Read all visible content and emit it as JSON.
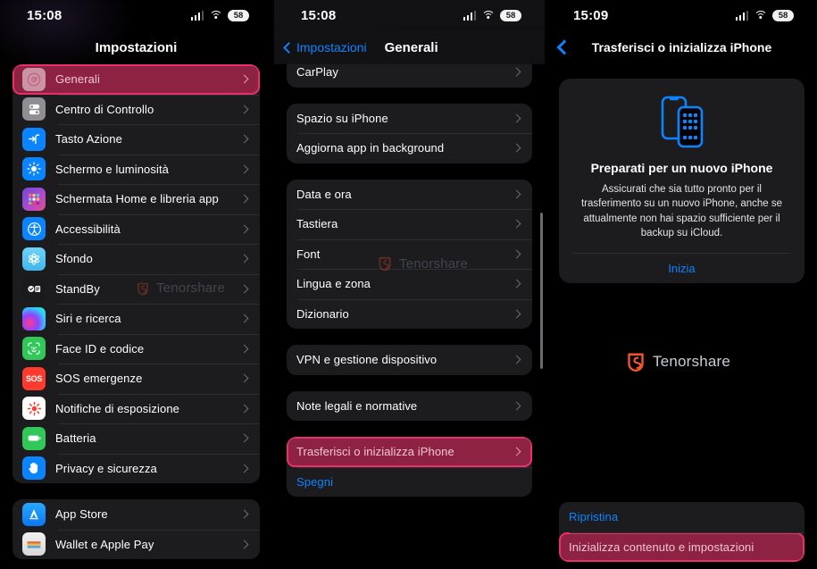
{
  "panels": {
    "left": {
      "status": {
        "time": "15:08",
        "battery": "58"
      },
      "nav_title": "Impostazioni",
      "groups": [
        {
          "items": [
            {
              "label": "Generali",
              "icon": "settings-gear-icon",
              "icon_style": "i-genhl",
              "highlight": true
            },
            {
              "label": "Centro di Controllo",
              "icon": "control-center-icon",
              "icon_style": "i-gray"
            },
            {
              "label": "Tasto Azione",
              "icon": "action-button-icon",
              "icon_style": "i-blue"
            },
            {
              "label": "Schermo e luminosità",
              "icon": "brightness-icon",
              "icon_style": "i-blue"
            },
            {
              "label": "Schermata Home e libreria app",
              "icon": "home-screen-icon",
              "icon_style": "i-purplegrad"
            },
            {
              "label": "Accessibilità",
              "icon": "accessibility-icon",
              "icon_style": "i-blue"
            },
            {
              "label": "Sfondo",
              "icon": "wallpaper-icon",
              "icon_style": "i-skyblue"
            },
            {
              "label": "StandBy",
              "icon": "standby-icon",
              "icon_style": "i-black"
            },
            {
              "label": "Siri e ricerca",
              "icon": "siri-icon",
              "icon_style": "i-sirigrad"
            },
            {
              "label": "Face ID e codice",
              "icon": "face-id-icon",
              "icon_style": "i-green"
            },
            {
              "label": "SOS emergenze",
              "icon": "sos-icon",
              "icon_style": "i-red"
            },
            {
              "label": "Notifiche di esposizione",
              "icon": "exposure-notification-icon",
              "icon_style": "i-white"
            },
            {
              "label": "Batteria",
              "icon": "battery-icon",
              "icon_style": "i-green"
            },
            {
              "label": "Privacy e sicurezza",
              "icon": "privacy-hand-icon",
              "icon_style": "i-blue"
            }
          ]
        },
        {
          "items": [
            {
              "label": "App Store",
              "icon": "app-store-icon",
              "icon_style": "i-appstore"
            },
            {
              "label": "Wallet e Apple Pay",
              "icon": "wallet-icon",
              "icon_style": "i-wallet"
            }
          ]
        }
      ],
      "watermark": {
        "text": "Tenorshare"
      }
    },
    "middle": {
      "status": {
        "time": "15:08",
        "battery": "58"
      },
      "back_label": "Impostazioni",
      "nav_title": "Generali",
      "groups": [
        {
          "items": [
            {
              "label": "CarPlay"
            }
          ]
        },
        {
          "items": [
            {
              "label": "Spazio su iPhone"
            },
            {
              "label": "Aggiorna app in background"
            }
          ]
        },
        {
          "items": [
            {
              "label": "Data e ora"
            },
            {
              "label": "Tastiera"
            },
            {
              "label": "Font"
            },
            {
              "label": "Lingua e zona"
            },
            {
              "label": "Dizionario"
            }
          ]
        },
        {
          "items": [
            {
              "label": "VPN e gestione dispositivo"
            }
          ]
        },
        {
          "items": [
            {
              "label": "Note legali e normative"
            }
          ]
        },
        {
          "items": [
            {
              "label": "Trasferisci o inizializza iPhone",
              "highlight": true
            },
            {
              "label": "Spegni",
              "style": "blue",
              "no_chevron": true
            }
          ]
        }
      ],
      "watermark": {
        "text": "Tenorshare"
      }
    },
    "right": {
      "status": {
        "time": "15:09",
        "battery": "58"
      },
      "nav_title": "Trasferisci o inizializza iPhone",
      "card": {
        "icon": "two-iphones-icon",
        "title": "Preparati per un nuovo iPhone",
        "body": "Assicurati che sia tutto pronto per il trasferimento su un nuovo iPhone, anche se attualmente non hai spazio sufficiente per il backup su iCloud.",
        "action": "Inizia"
      },
      "watermark": {
        "text": "Tenorshare"
      },
      "bottom_group": [
        {
          "label": "Ripristina",
          "style": "blue",
          "no_chevron": true
        },
        {
          "label": "Inizializza contenuto e impostazioni",
          "highlight": true,
          "no_chevron": true
        }
      ]
    }
  },
  "colors": {
    "accent_blue": "#0a84ff",
    "highlight_fill": "#8e2243",
    "highlight_border": "#e8316b",
    "card_bg": "#1c1c1e",
    "watermark_orange": "#f2542d"
  }
}
